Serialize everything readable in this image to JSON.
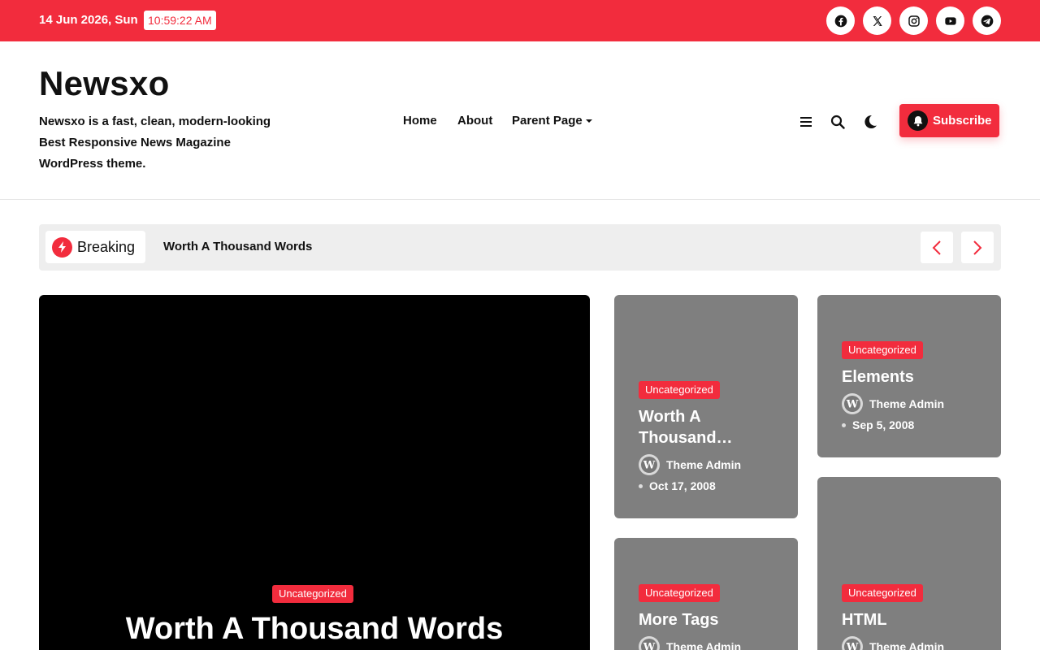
{
  "topbar": {
    "date": "14 Jun 2026, Sun",
    "time": "10:59:22 AM",
    "social": [
      "facebook-icon",
      "x-icon",
      "instagram-icon",
      "youtube-icon",
      "telegram-icon"
    ]
  },
  "header": {
    "site_title": "Newsxo",
    "site_description": "Newsxo is a fast, clean, modern-looking Best Responsive News Magazine WordPress theme.",
    "nav": [
      {
        "label": "Home"
      },
      {
        "label": "About"
      },
      {
        "label": "Parent Page"
      }
    ],
    "subscribe_label": "Subscribe"
  },
  "breaking": {
    "label": "Breaking",
    "headline": "Worth A Thousand Words"
  },
  "featured": {
    "category": "Uncategorized",
    "title": "Worth A Thousand Words"
  },
  "cards": [
    {
      "category": "Uncategorized",
      "title": "Worth A Thousand…",
      "author": "Theme Admin",
      "date": "Oct 17, 2008"
    },
    {
      "category": "Uncategorized",
      "title": "Elements",
      "author": "Theme Admin",
      "date": "Sep 5, 2008"
    },
    {
      "category": "Uncategorized",
      "title": "More Tags",
      "author": "Theme Admin"
    },
    {
      "category": "Uncategorized",
      "title": "HTML",
      "author": "Theme Admin"
    }
  ],
  "colors": {
    "accent": "#f22c3d",
    "card_bg": "#7f7f7f",
    "breaking_bg": "#eeeeee"
  }
}
